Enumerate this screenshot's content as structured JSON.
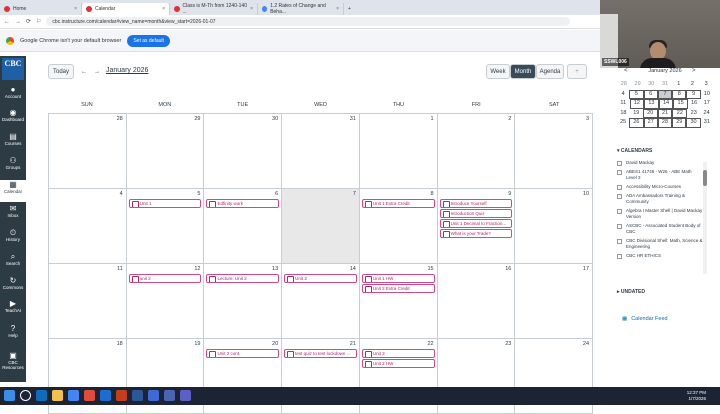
{
  "browser": {
    "tabs": [
      {
        "label": "Home",
        "icon": "canvas-icon"
      },
      {
        "label": "Calendar",
        "icon": "canvas-icon"
      },
      {
        "label": "Class is M-Th from 1240-140 ...",
        "icon": "canvas-icon"
      },
      {
        "label": "1.2 Rates of Change and Beha...",
        "icon": "doc-icon"
      }
    ],
    "new_tab": "+",
    "url": "cbc.instructure.com/calendar#view_name=month&view_start=2026-01-07",
    "info_text": "Google Chrome isn't your default browser",
    "set_default_label": "Set as default"
  },
  "global_nav": {
    "logo_text": "CBC",
    "items": [
      {
        "label": "Account",
        "icon": "account-icon"
      },
      {
        "label": "Dashboard",
        "icon": "dashboard-icon"
      },
      {
        "label": "Courses",
        "icon": "courses-icon"
      },
      {
        "label": "Groups",
        "icon": "groups-icon"
      },
      {
        "label": "Calendar",
        "icon": "calendar-icon",
        "active": true
      },
      {
        "label": "Inbox",
        "icon": "inbox-icon"
      },
      {
        "label": "History",
        "icon": "history-icon"
      },
      {
        "label": "Search",
        "icon": "search-icon"
      },
      {
        "label": "Commons",
        "icon": "commons-icon"
      },
      {
        "label": "TeachAI",
        "icon": "teachai-icon"
      },
      {
        "label": "Help",
        "icon": "help-icon"
      },
      {
        "label": "CBC Resources",
        "icon": "resources-icon"
      }
    ]
  },
  "toolbar": {
    "today_label": "Today",
    "prev": "←",
    "next": "→",
    "month_title": "January 2026",
    "views": [
      "Week",
      "Month",
      "Agenda"
    ],
    "active_view": "Month",
    "add": "+"
  },
  "calendar": {
    "days_of_week": [
      "SUN",
      "MON",
      "TUE",
      "WED",
      "THU",
      "FRI",
      "SAT"
    ],
    "weeks": [
      [
        {
          "d": "28"
        },
        {
          "d": "29"
        },
        {
          "d": "30"
        },
        {
          "d": "31"
        },
        {
          "d": "1"
        },
        {
          "d": "2"
        },
        {
          "d": "3"
        }
      ],
      [
        {
          "d": "4"
        },
        {
          "d": "5",
          "events": [
            "Unit 1"
          ]
        },
        {
          "d": "6",
          "events": [
            "Edfinity work"
          ]
        },
        {
          "d": "7",
          "today": true
        },
        {
          "d": "8",
          "events": [
            "Unit 1 Extra Credit"
          ]
        },
        {
          "d": "9",
          "events": [
            "Introduce Yourself",
            "Introduction Quiz",
            "Unit 1 Decimal to Fraction...",
            "What is your Trade?"
          ]
        },
        {
          "d": "10"
        }
      ],
      [
        {
          "d": "11"
        },
        {
          "d": "12",
          "events": [
            "unit 2"
          ]
        },
        {
          "d": "13",
          "events": [
            "Lecture: Unit 2"
          ]
        },
        {
          "d": "14",
          "events": [
            "Unit 2"
          ]
        },
        {
          "d": "15",
          "events": [
            "Unit 1 HW",
            "Unit 2 Extra Credit"
          ]
        },
        {
          "d": "16"
        },
        {
          "d": "17"
        }
      ],
      [
        {
          "d": "18"
        },
        {
          "d": "19"
        },
        {
          "d": "20",
          "events": [
            "Unit 2 cont."
          ]
        },
        {
          "d": "21",
          "events": [
            "test quiz to test lockdown ..."
          ]
        },
        {
          "d": "22",
          "events": [
            "Unit 3",
            "Unit 2 HW"
          ]
        },
        {
          "d": "23"
        },
        {
          "d": "24"
        }
      ]
    ]
  },
  "sidebar": {
    "mini_title": "January 2026",
    "mini_prev": "<",
    "mini_next": ">",
    "mini_rows": [
      [
        {
          "d": "28",
          "dim": true
        },
        {
          "d": "29",
          "dim": true
        },
        {
          "d": "30",
          "dim": true
        },
        {
          "d": "31",
          "dim": true
        },
        {
          "d": "1"
        },
        {
          "d": "2"
        },
        {
          "d": "3"
        }
      ],
      [
        {
          "d": "4"
        },
        {
          "d": "5",
          "box": true
        },
        {
          "d": "6",
          "box": true
        },
        {
          "d": "7",
          "sel": true
        },
        {
          "d": "8",
          "box": true
        },
        {
          "d": "9",
          "box": true
        },
        {
          "d": "10"
        }
      ],
      [
        {
          "d": "11"
        },
        {
          "d": "12",
          "box": true
        },
        {
          "d": "13",
          "box": true
        },
        {
          "d": "14",
          "box": true
        },
        {
          "d": "15",
          "box": true
        },
        {
          "d": "16"
        },
        {
          "d": "17"
        }
      ],
      [
        {
          "d": "18"
        },
        {
          "d": "19"
        },
        {
          "d": "20",
          "box": true
        },
        {
          "d": "21",
          "box": true
        },
        {
          "d": "22",
          "box": true
        },
        {
          "d": "23"
        },
        {
          "d": "24"
        }
      ],
      [
        {
          "d": "25"
        },
        {
          "d": "26",
          "box": true
        },
        {
          "d": "27",
          "box": true
        },
        {
          "d": "28",
          "box": true
        },
        {
          "d": "29",
          "box": true
        },
        {
          "d": "30",
          "box": true
        },
        {
          "d": "31"
        }
      ]
    ],
    "calendars_title": "CALENDARS",
    "calendars": [
      "David Mackay",
      "ABES1 41746 - W26 - ABE Math Level 3",
      "Accessibility Micro-Courses",
      "ADA Ambassadors Training & Community",
      "Algebra I Master Shell | David Mackay Version",
      "ASCBC - Associated Student Body of CBC",
      "CBC Divisional Shell: Math, Science & Engineering",
      "CBC HR ETHICS"
    ],
    "undated_title": "UNDATED",
    "feed_label": "Calendar Feed"
  },
  "webcam": {
    "label": "SSWL006"
  },
  "taskbar": {
    "time": "12:37 PM",
    "date": "1/7/2026"
  },
  "colors": {
    "event": "#cf4a8a",
    "nav_bg": "#2d3b45",
    "active_view": "#394b58",
    "accent": "#1a73e8"
  }
}
